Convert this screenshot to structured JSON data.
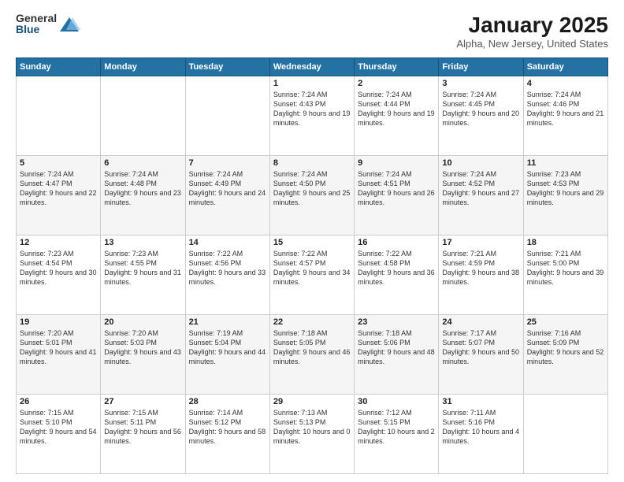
{
  "header": {
    "logo_general": "General",
    "logo_blue": "Blue",
    "title": "January 2025",
    "location": "Alpha, New Jersey, United States"
  },
  "days_of_week": [
    "Sunday",
    "Monday",
    "Tuesday",
    "Wednesday",
    "Thursday",
    "Friday",
    "Saturday"
  ],
  "weeks": [
    [
      {
        "day": "",
        "text": ""
      },
      {
        "day": "",
        "text": ""
      },
      {
        "day": "",
        "text": ""
      },
      {
        "day": "1",
        "text": "Sunrise: 7:24 AM\nSunset: 4:43 PM\nDaylight: 9 hours and 19 minutes."
      },
      {
        "day": "2",
        "text": "Sunrise: 7:24 AM\nSunset: 4:44 PM\nDaylight: 9 hours and 19 minutes."
      },
      {
        "day": "3",
        "text": "Sunrise: 7:24 AM\nSunset: 4:45 PM\nDaylight: 9 hours and 20 minutes."
      },
      {
        "day": "4",
        "text": "Sunrise: 7:24 AM\nSunset: 4:46 PM\nDaylight: 9 hours and 21 minutes."
      }
    ],
    [
      {
        "day": "5",
        "text": "Sunrise: 7:24 AM\nSunset: 4:47 PM\nDaylight: 9 hours and 22 minutes."
      },
      {
        "day": "6",
        "text": "Sunrise: 7:24 AM\nSunset: 4:48 PM\nDaylight: 9 hours and 23 minutes."
      },
      {
        "day": "7",
        "text": "Sunrise: 7:24 AM\nSunset: 4:49 PM\nDaylight: 9 hours and 24 minutes."
      },
      {
        "day": "8",
        "text": "Sunrise: 7:24 AM\nSunset: 4:50 PM\nDaylight: 9 hours and 25 minutes."
      },
      {
        "day": "9",
        "text": "Sunrise: 7:24 AM\nSunset: 4:51 PM\nDaylight: 9 hours and 26 minutes."
      },
      {
        "day": "10",
        "text": "Sunrise: 7:24 AM\nSunset: 4:52 PM\nDaylight: 9 hours and 27 minutes."
      },
      {
        "day": "11",
        "text": "Sunrise: 7:23 AM\nSunset: 4:53 PM\nDaylight: 9 hours and 29 minutes."
      }
    ],
    [
      {
        "day": "12",
        "text": "Sunrise: 7:23 AM\nSunset: 4:54 PM\nDaylight: 9 hours and 30 minutes."
      },
      {
        "day": "13",
        "text": "Sunrise: 7:23 AM\nSunset: 4:55 PM\nDaylight: 9 hours and 31 minutes."
      },
      {
        "day": "14",
        "text": "Sunrise: 7:22 AM\nSunset: 4:56 PM\nDaylight: 9 hours and 33 minutes."
      },
      {
        "day": "15",
        "text": "Sunrise: 7:22 AM\nSunset: 4:57 PM\nDaylight: 9 hours and 34 minutes."
      },
      {
        "day": "16",
        "text": "Sunrise: 7:22 AM\nSunset: 4:58 PM\nDaylight: 9 hours and 36 minutes."
      },
      {
        "day": "17",
        "text": "Sunrise: 7:21 AM\nSunset: 4:59 PM\nDaylight: 9 hours and 38 minutes."
      },
      {
        "day": "18",
        "text": "Sunrise: 7:21 AM\nSunset: 5:00 PM\nDaylight: 9 hours and 39 minutes."
      }
    ],
    [
      {
        "day": "19",
        "text": "Sunrise: 7:20 AM\nSunset: 5:01 PM\nDaylight: 9 hours and 41 minutes."
      },
      {
        "day": "20",
        "text": "Sunrise: 7:20 AM\nSunset: 5:03 PM\nDaylight: 9 hours and 43 minutes."
      },
      {
        "day": "21",
        "text": "Sunrise: 7:19 AM\nSunset: 5:04 PM\nDaylight: 9 hours and 44 minutes."
      },
      {
        "day": "22",
        "text": "Sunrise: 7:18 AM\nSunset: 5:05 PM\nDaylight: 9 hours and 46 minutes."
      },
      {
        "day": "23",
        "text": "Sunrise: 7:18 AM\nSunset: 5:06 PM\nDaylight: 9 hours and 48 minutes."
      },
      {
        "day": "24",
        "text": "Sunrise: 7:17 AM\nSunset: 5:07 PM\nDaylight: 9 hours and 50 minutes."
      },
      {
        "day": "25",
        "text": "Sunrise: 7:16 AM\nSunset: 5:09 PM\nDaylight: 9 hours and 52 minutes."
      }
    ],
    [
      {
        "day": "26",
        "text": "Sunrise: 7:15 AM\nSunset: 5:10 PM\nDaylight: 9 hours and 54 minutes."
      },
      {
        "day": "27",
        "text": "Sunrise: 7:15 AM\nSunset: 5:11 PM\nDaylight: 9 hours and 56 minutes."
      },
      {
        "day": "28",
        "text": "Sunrise: 7:14 AM\nSunset: 5:12 PM\nDaylight: 9 hours and 58 minutes."
      },
      {
        "day": "29",
        "text": "Sunrise: 7:13 AM\nSunset: 5:13 PM\nDaylight: 10 hours and 0 minutes."
      },
      {
        "day": "30",
        "text": "Sunrise: 7:12 AM\nSunset: 5:15 PM\nDaylight: 10 hours and 2 minutes."
      },
      {
        "day": "31",
        "text": "Sunrise: 7:11 AM\nSunset: 5:16 PM\nDaylight: 10 hours and 4 minutes."
      },
      {
        "day": "",
        "text": ""
      }
    ]
  ]
}
